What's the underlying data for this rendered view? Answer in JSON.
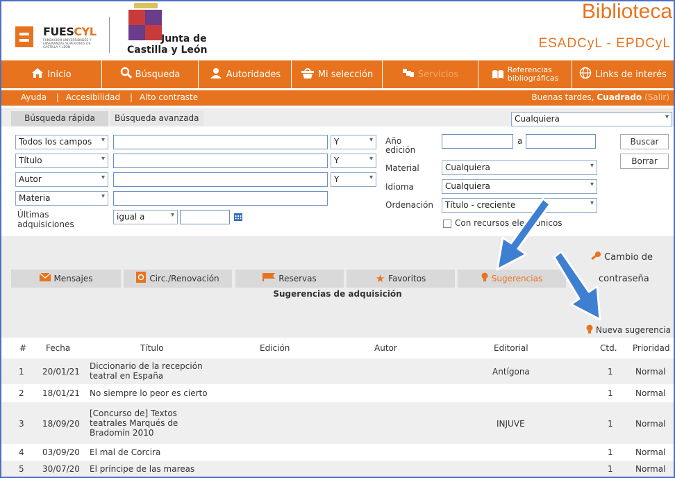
{
  "header": {
    "fuescyl_left": "FUES",
    "fuescyl_right": "CYL",
    "fuescyl_sub": "FUNDACIÓN UNIVERSIDADES Y ENSEÑANZAS SUPERIORES DE CASTILLA Y LEÓN",
    "junta_line1": "Junta de",
    "junta_line2": "Castilla y León",
    "site_title": "Biblioteca",
    "site_subtitle": "ESADCyL - EPDCyL"
  },
  "nav": {
    "items": [
      {
        "label": "Inicio",
        "icon": "home-icon"
      },
      {
        "label": "Búsqueda",
        "icon": "search-icon"
      },
      {
        "label": "Autoridades",
        "icon": "users-icon"
      },
      {
        "label": "Mi selección",
        "icon": "basket-icon"
      },
      {
        "label": "Servicios",
        "icon": "services-icon"
      },
      {
        "label_line1": "Referencias",
        "label_line2": "bibliográficas",
        "icon": "book-icon"
      },
      {
        "label": "Links de interés",
        "icon": "globe-icon"
      }
    ]
  },
  "subnav": {
    "ayuda": "Ayuda",
    "accesibilidad": "Accesibilidad",
    "contraste": "Alto contraste",
    "sep": "|",
    "greeting": "Buenas tardes,",
    "user": "Cuadrado",
    "salir": "(Salir)"
  },
  "search": {
    "tab_rapida": "Búsqueda rápida",
    "tab_avanzada": "Búsqueda avanzada",
    "scope_select": "Cualquiera",
    "fields": [
      "Todos los campos",
      "Título",
      "Autor",
      "Materia"
    ],
    "operators": [
      "Y",
      "Y",
      "Y"
    ],
    "ultimas_label": "Últimas adquisiciones",
    "ultimas_op": "igual a",
    "anio_label": "Año edición",
    "anio_sep": "a",
    "material_label": "Material",
    "material_value": "Cualquiera",
    "idioma_label": "Idioma",
    "idioma_value": "Cualquiera",
    "orden_label": "Ordenación",
    "orden_value": "Título - creciente",
    "recursos_label": "Con recursos electrónicos",
    "buscar": "Buscar",
    "borrar": "Borrar"
  },
  "user_tabs": {
    "cambio_line1": "Cambio de",
    "cambio_line2": "contraseña",
    "items": [
      {
        "label": "Mensajes",
        "icon": "mail-icon"
      },
      {
        "label": "Circ./Renovación",
        "icon": "circulation-icon"
      },
      {
        "label": "Reservas",
        "icon": "flag-icon"
      },
      {
        "label": "Favoritos",
        "icon": "star-icon"
      },
      {
        "label": "Sugerencias",
        "icon": "bulb-icon"
      }
    ]
  },
  "suggestions": {
    "title": "Sugerencias de adquisición",
    "new_label": "Nueva sugerencia",
    "columns": [
      "#",
      "Fecha",
      "Título",
      "Edición",
      "Autor",
      "Editorial",
      "Ctd.",
      "Prioridad"
    ],
    "rows": [
      {
        "n": "1",
        "fecha": "20/01/21",
        "titulo": "Diccionario de la recepción teatral en España",
        "editorial": "Antígona",
        "ctd": "1",
        "prioridad": "Normal"
      },
      {
        "n": "2",
        "fecha": "18/01/21",
        "titulo": "No siempre lo peor es cierto",
        "editorial": "",
        "ctd": "1",
        "prioridad": "Normal"
      },
      {
        "n": "3",
        "fecha": "18/09/20",
        "titulo": "[Concurso de] Textos teatrales Marqués de Bradomín 2010",
        "editorial": "INJUVE",
        "ctd": "1",
        "prioridad": "Normal"
      },
      {
        "n": "4",
        "fecha": "03/09/20",
        "titulo": "El mal de Corcira",
        "editorial": "",
        "ctd": "1",
        "prioridad": "Normal"
      },
      {
        "n": "5",
        "fecha": "30/07/20",
        "titulo": "El príncipe de las mareas",
        "editorial": "",
        "ctd": "1",
        "prioridad": "Normal"
      }
    ]
  },
  "colors": {
    "brand": "#e8731e",
    "arrow": "#3f7fd1",
    "frame": "#4a6fc2"
  }
}
